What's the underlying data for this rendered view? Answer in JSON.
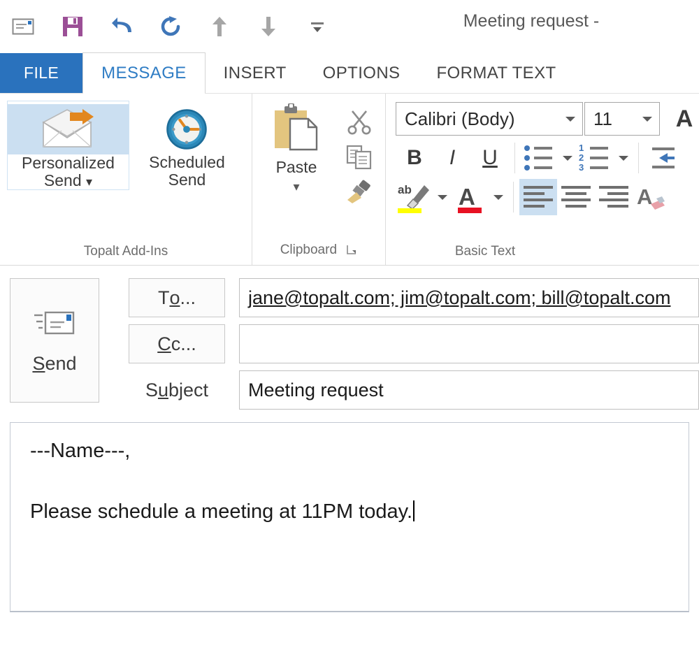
{
  "window": {
    "title": "Meeting request -"
  },
  "quick_access": {
    "items": [
      {
        "name": "message-icon",
        "label": "Message"
      },
      {
        "name": "save-icon",
        "label": "Save"
      },
      {
        "name": "undo-icon",
        "label": "Undo"
      },
      {
        "name": "redo-icon",
        "label": "Redo"
      },
      {
        "name": "previous-item-icon",
        "label": "Previous Item"
      },
      {
        "name": "next-item-icon",
        "label": "Next Item"
      },
      {
        "name": "customize-quick-access-toolbar-icon",
        "label": "Customize Quick Access Toolbar"
      }
    ]
  },
  "tabs": [
    {
      "label": "FILE",
      "active": false,
      "file": true
    },
    {
      "label": "MESSAGE",
      "active": true,
      "file": false
    },
    {
      "label": "INSERT",
      "active": false,
      "file": false
    },
    {
      "label": "OPTIONS",
      "active": false,
      "file": false
    },
    {
      "label": "FORMAT TEXT",
      "active": false,
      "file": false
    }
  ],
  "ribbon": {
    "groups": {
      "topalt": {
        "label": "Topalt Add-Ins",
        "personalized_send": "Personalized Send",
        "personalized_send_line1": "Personalized",
        "personalized_send_line2": "Send",
        "scheduled_send_line1": "Scheduled",
        "scheduled_send_line2": "Send"
      },
      "clipboard": {
        "label": "Clipboard",
        "paste": "Paste",
        "cut": "Cut",
        "copy": "Copy",
        "format_painter": "Format Painter"
      },
      "basic_text": {
        "label": "Basic Text",
        "font_name": "Calibri (Body)",
        "font_size": "11",
        "bold": "B",
        "italic": "I",
        "underline": "U",
        "bullets": "Bullets",
        "numbering": "Numbering",
        "highlight": "ab",
        "font_color": "A",
        "align_left": "Align Left",
        "align_center": "Center",
        "align_right": "Align Right",
        "grow_font": "A",
        "decrease_indent": "Decrease Indent",
        "clear_formatting": "A"
      }
    }
  },
  "compose": {
    "send_label": "Send",
    "to_label": "To...",
    "cc_label": "Cc...",
    "subject_label": "Subject",
    "to_value": "jane@topalt.com; jim@topalt.com; bill@topalt.com",
    "cc_value": "",
    "subject_value": "Meeting request",
    "body_line1": "---Name---,",
    "body_line2": "Please schedule a meeting at 11PM today."
  },
  "colors": {
    "accent": "#2a72bd",
    "tab_active_text": "#2e7cc4",
    "save_icon": "#9b4f96",
    "undo_redo": "#3f76b8",
    "highlight_yellow": "#ffff00",
    "font_color_red": "#e81123",
    "selection_blue": "#cbdff1",
    "clipboard_gold": "#e3c57f"
  }
}
